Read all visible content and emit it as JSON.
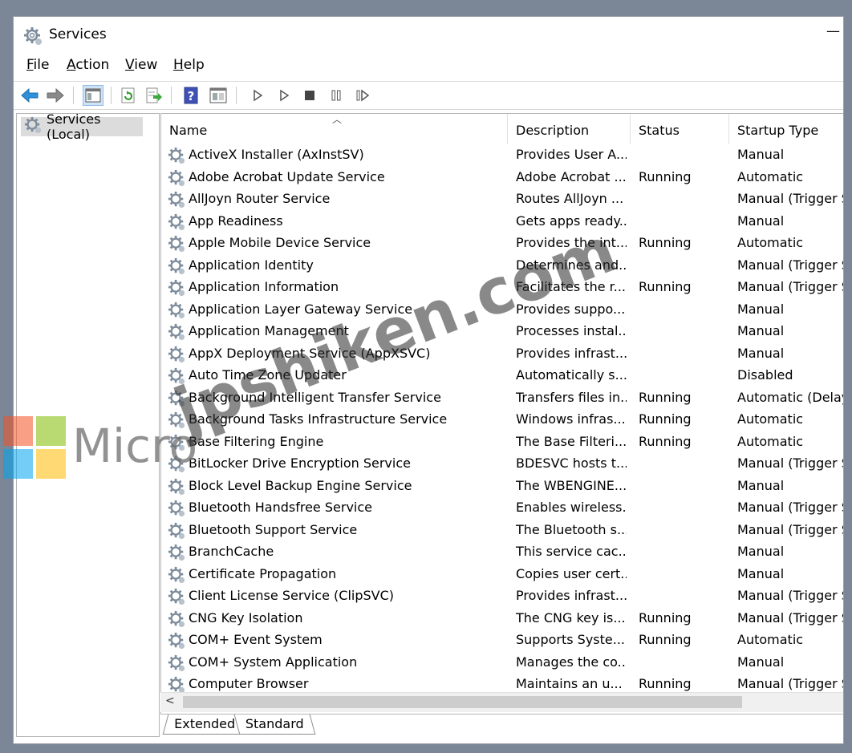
{
  "window": {
    "title": "Services",
    "minimize": "—"
  },
  "menu": [
    {
      "label": "File",
      "accel": "F",
      "rest": "ile"
    },
    {
      "label": "Action",
      "accel": "A",
      "rest": "ction"
    },
    {
      "label": "View",
      "accel": "V",
      "rest": "iew"
    },
    {
      "label": "Help",
      "accel": "H",
      "rest": "elp"
    }
  ],
  "toolbar": [
    "back-arrow-icon",
    "forward-arrow-icon",
    "show-hide-console-tree-icon",
    "refresh-icon",
    "export-list-icon",
    "help-icon",
    "properties-icon",
    "start-service-icon",
    "start-alt-icon",
    "stop-service-icon",
    "pause-service-icon",
    "resume-service-icon"
  ],
  "tree": {
    "root_label": "Services (Local)"
  },
  "columns": {
    "name": "Name",
    "description": "Description",
    "status": "Status",
    "startup": "Startup Type"
  },
  "rows": [
    {
      "name": "ActiveX Installer (AxInstSV)",
      "desc": "Provides User A...",
      "status": "",
      "startup": "Manual"
    },
    {
      "name": "Adobe Acrobat Update Service",
      "desc": "Adobe Acrobat ...",
      "status": "Running",
      "startup": "Automatic"
    },
    {
      "name": "AllJoyn Router Service",
      "desc": "Routes AllJoyn ...",
      "status": "",
      "startup": "Manual (Trigger S"
    },
    {
      "name": "App Readiness",
      "desc": "Gets apps ready...",
      "status": "",
      "startup": "Manual"
    },
    {
      "name": "Apple Mobile Device Service",
      "desc": "Provides the int...",
      "status": "Running",
      "startup": "Automatic"
    },
    {
      "name": "Application Identity",
      "desc": "Determines and...",
      "status": "",
      "startup": "Manual (Trigger S"
    },
    {
      "name": "Application Information",
      "desc": "Facilitates the r...",
      "status": "Running",
      "startup": "Manual (Trigger S"
    },
    {
      "name": "Application Layer Gateway Service",
      "desc": "Provides suppo...",
      "status": "",
      "startup": "Manual"
    },
    {
      "name": "Application Management",
      "desc": "Processes instal...",
      "status": "",
      "startup": "Manual"
    },
    {
      "name": "AppX Deployment Service (AppXSVC)",
      "desc": "Provides infrast...",
      "status": "",
      "startup": "Manual"
    },
    {
      "name": "Auto Time Zone Updater",
      "desc": "Automatically s...",
      "status": "",
      "startup": "Disabled"
    },
    {
      "name": "Background Intelligent Transfer Service",
      "desc": "Transfers files in...",
      "status": "Running",
      "startup": "Automatic (Delay"
    },
    {
      "name": "Background Tasks Infrastructure Service",
      "desc": "Windows infras...",
      "status": "Running",
      "startup": "Automatic"
    },
    {
      "name": "Base Filtering Engine",
      "desc": "The Base Filteri...",
      "status": "Running",
      "startup": "Automatic"
    },
    {
      "name": "BitLocker Drive Encryption Service",
      "desc": "BDESVC hosts t...",
      "status": "",
      "startup": "Manual (Trigger S"
    },
    {
      "name": "Block Level Backup Engine Service",
      "desc": "The WBENGINE...",
      "status": "",
      "startup": "Manual"
    },
    {
      "name": "Bluetooth Handsfree Service",
      "desc": "Enables wireless...",
      "status": "",
      "startup": "Manual (Trigger S"
    },
    {
      "name": "Bluetooth Support Service",
      "desc": "The Bluetooth s...",
      "status": "",
      "startup": "Manual (Trigger S"
    },
    {
      "name": "BranchCache",
      "desc": "This service cac...",
      "status": "",
      "startup": "Manual"
    },
    {
      "name": "Certificate Propagation",
      "desc": "Copies user cert...",
      "status": "",
      "startup": "Manual"
    },
    {
      "name": "Client License Service (ClipSVC)",
      "desc": "Provides infrast...",
      "status": "",
      "startup": "Manual (Trigger S"
    },
    {
      "name": "CNG Key Isolation",
      "desc": "The CNG key is...",
      "status": "Running",
      "startup": "Manual (Trigger S"
    },
    {
      "name": "COM+ Event System",
      "desc": "Supports Syste...",
      "status": "Running",
      "startup": "Automatic"
    },
    {
      "name": "COM+ System Application",
      "desc": "Manages the co...",
      "status": "",
      "startup": "Manual"
    },
    {
      "name": "Computer Browser",
      "desc": "Maintains an u...",
      "status": "Running",
      "startup": "Manual (Trigger S"
    }
  ],
  "scroll_arrow": "<",
  "tabs": [
    "Extended",
    "Standard"
  ],
  "watermark": {
    "site": "jpshiken.com",
    "brand": "Micro"
  },
  "colors": {
    "ms_red": "#f25022",
    "ms_green": "#7fba00",
    "ms_blue": "#00a4ef",
    "ms_yellow": "#ffb900"
  }
}
